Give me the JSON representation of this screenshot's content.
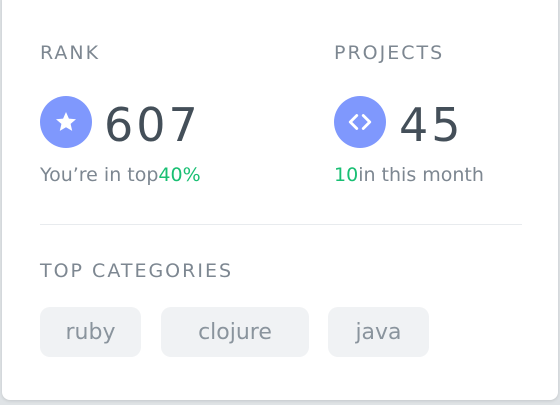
{
  "rank": {
    "label": "RANK",
    "value": "607",
    "sub_prefix": "You’re in top",
    "sub_highlight": "40%",
    "icon": "star-icon"
  },
  "projects": {
    "label": "PROJECTS",
    "value": "45",
    "sub_highlight": "10",
    "sub_suffix": "in this month",
    "icon": "code-icon"
  },
  "categories": {
    "label": "TOP CATEGORIES",
    "tags": [
      "ruby",
      "clojure",
      "java"
    ]
  },
  "colors": {
    "accent": "#7f98fd",
    "positive": "#19bf73"
  }
}
